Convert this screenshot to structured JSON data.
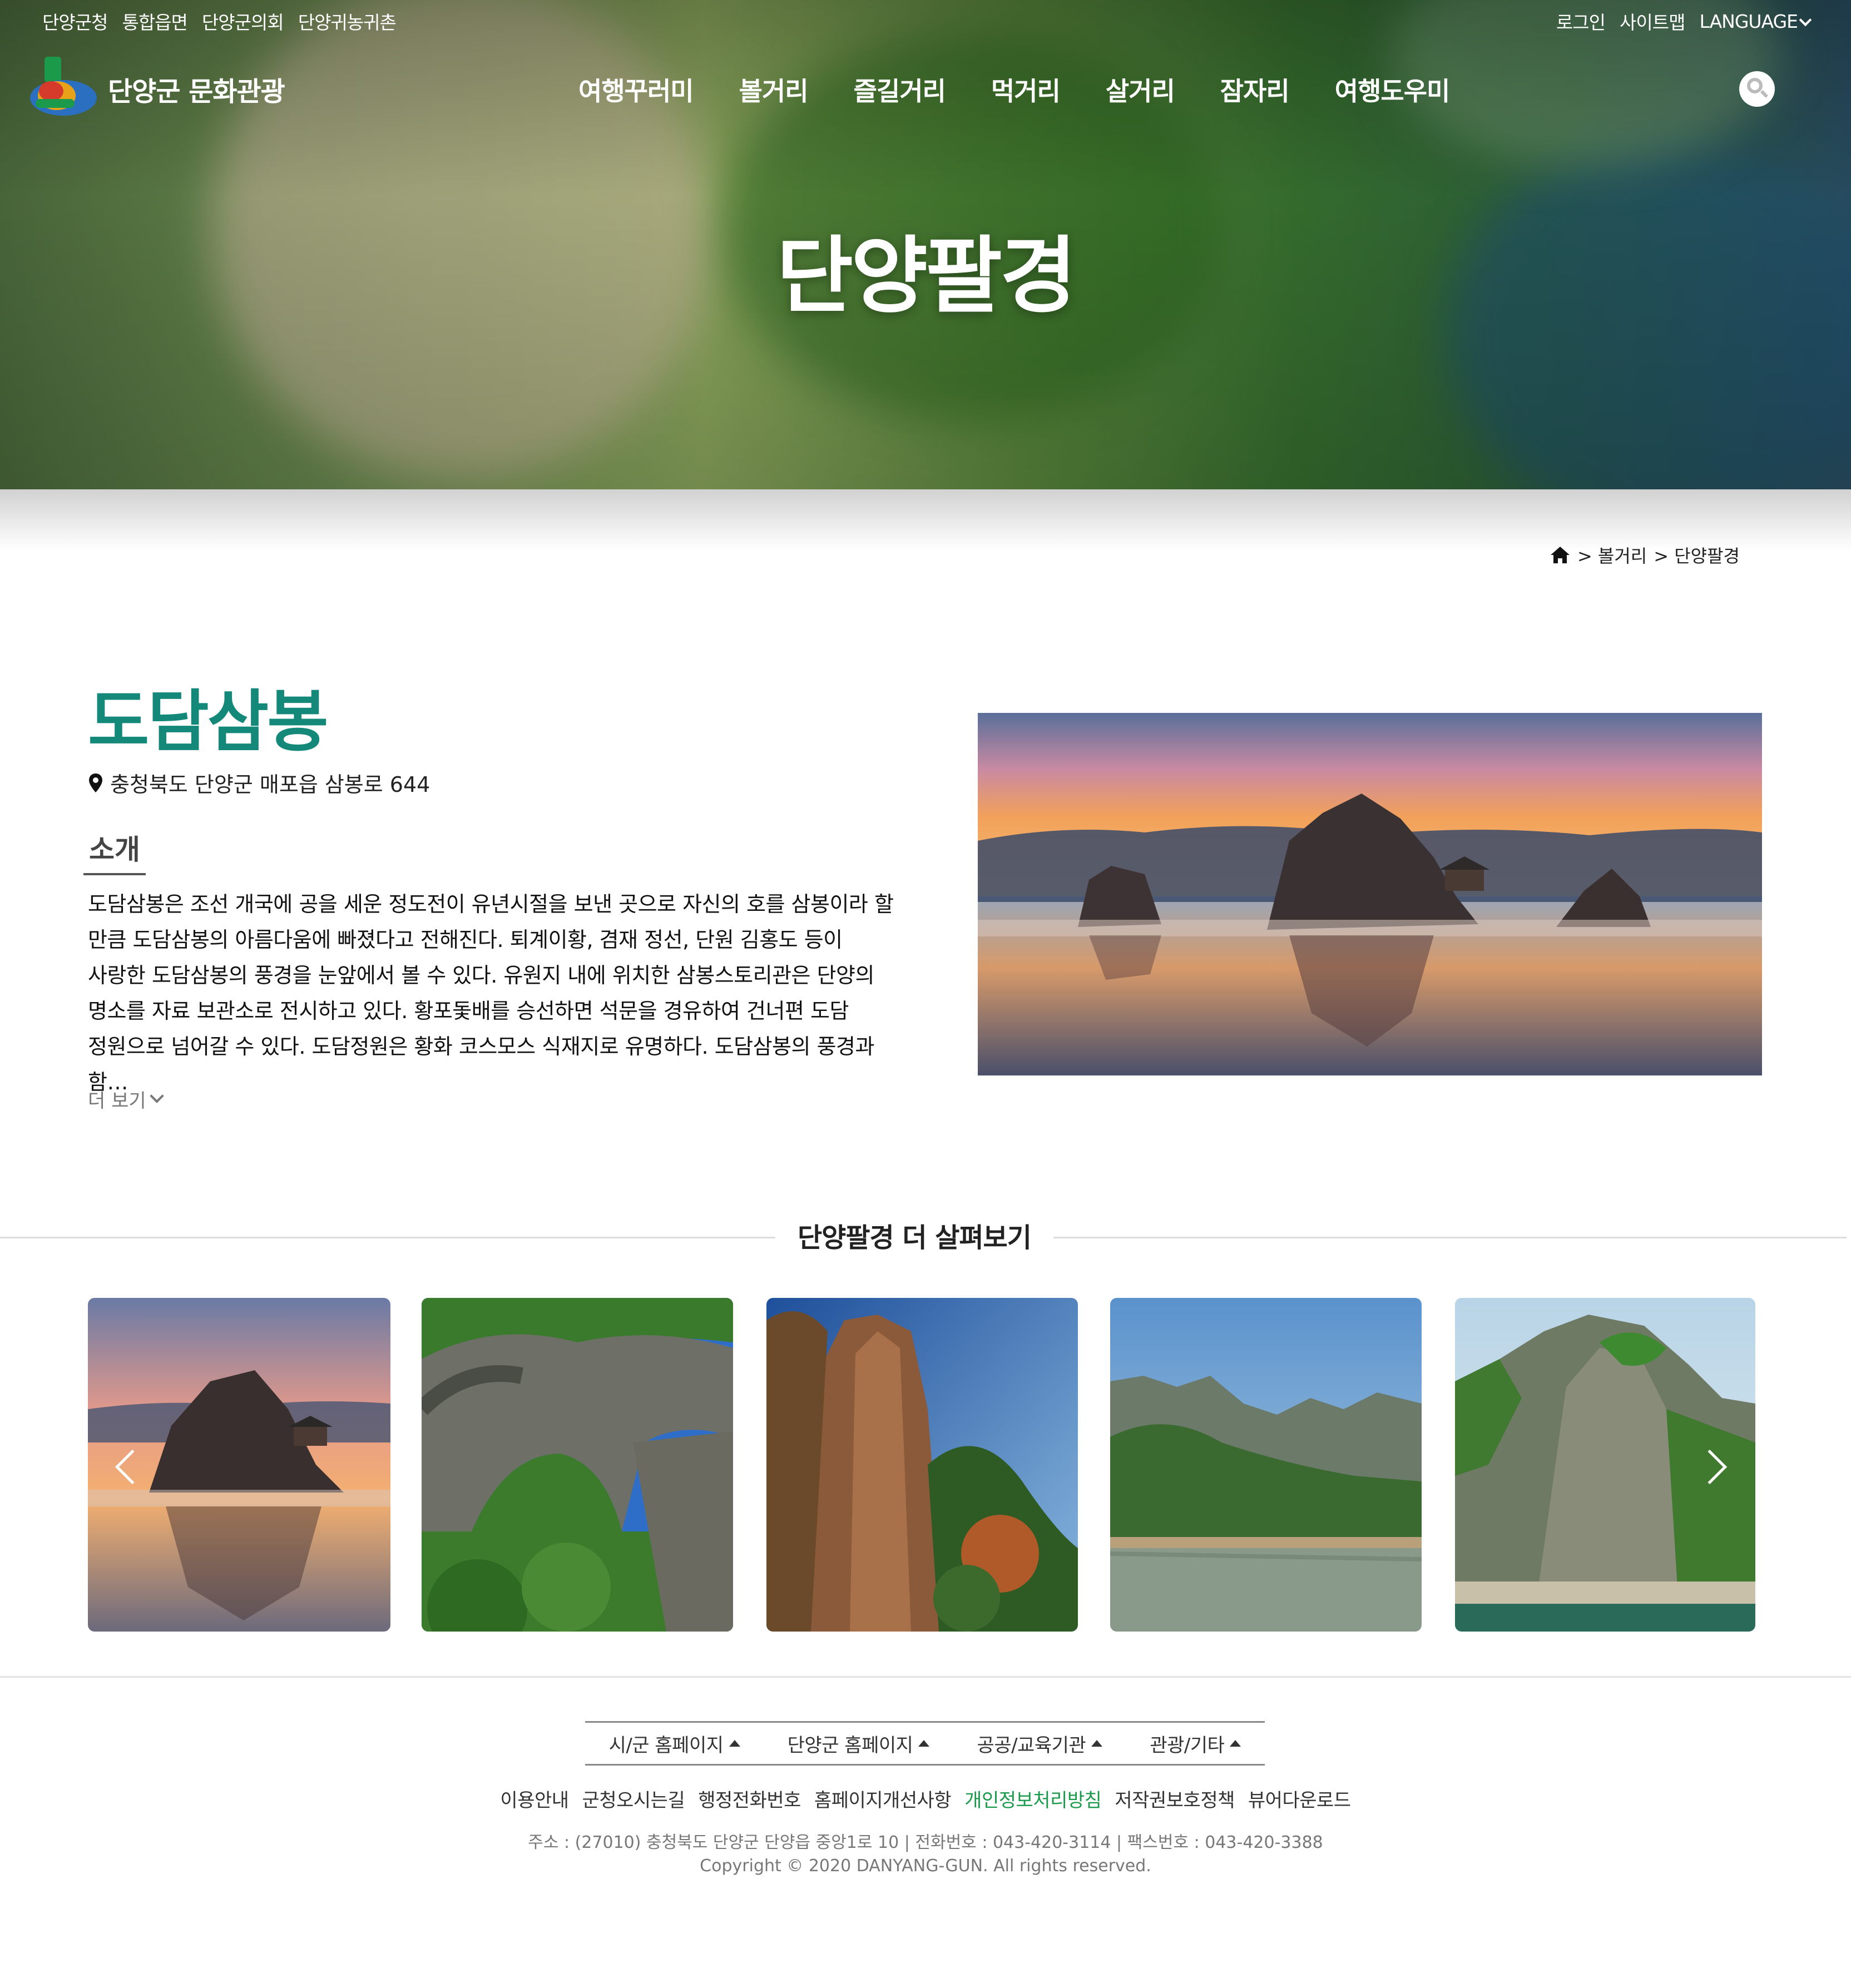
{
  "util": {
    "left_links": [
      "단양군청",
      "통합읍면",
      "단양군의회",
      "단양귀농귀촌"
    ],
    "right_links": [
      "로그인",
      "사이트맵"
    ],
    "language_label": "LANGUAGE"
  },
  "logo": {
    "text": "단양군 문화관광"
  },
  "gnb": [
    "여행꾸러미",
    "볼거리",
    "즐길거리",
    "먹거리",
    "살거리",
    "잠자리",
    "여행도우미"
  ],
  "hero": {
    "title": "단양팔경"
  },
  "breadcrumb": {
    "level1": "> 볼거리",
    "level2": "> 단양팔경"
  },
  "place": {
    "title": "도담삼봉",
    "address": "충청북도 단양군 매포읍 삼봉로 644",
    "intro_label": "소개",
    "intro_text": "도담삼봉은 조선 개국에 공을 세운 정도전이 유년시절을 보낸 곳으로 자신의 호를 삼봉이라 할 만큼 도담삼봉의 아름다움에 빠졌다고 전해진다. 퇴계이황, 겸재 정선, 단원 김홍도 등이 사랑한 도담삼봉의 풍경을 눈앞에서 볼 수 있다. 유원지 내에 위치한 삼봉스토리관은 단양의 명소를 자료 보관소로 전시하고 있다. 황포돛배를 승선하면 석문을 경유하여 건너편 도담 정원으로 넘어갈 수 있다. 도담정원은 황화 코스모스 식재지로 유명하다. 도담삼봉의 풍경과 함…",
    "more_label": "더 보기"
  },
  "more_section": {
    "title": "단양팔경 더 살펴보기"
  },
  "footer": {
    "menu": [
      "시/군 홈페이지",
      "단양군 홈페이지",
      "공공/교육기관",
      "관광/기타"
    ],
    "links": [
      "이용안내",
      "군청오시는길",
      "행정전화번호",
      "홈페이지개선사항",
      "개인정보처리방침",
      "저작권보호정책",
      "뷰어다운로드"
    ],
    "address": "주소 : (27010) 충청북도 단양군 단양읍 중앙1로 10 | 전화번호 : 043-420-3114 | 팩스번호 : 043-420-3388",
    "copyright": "Copyright © 2020 DANYANG-GUN. All rights reserved."
  },
  "colors": {
    "title_green": "#14897a",
    "accent_green": "#1a9a4a"
  }
}
